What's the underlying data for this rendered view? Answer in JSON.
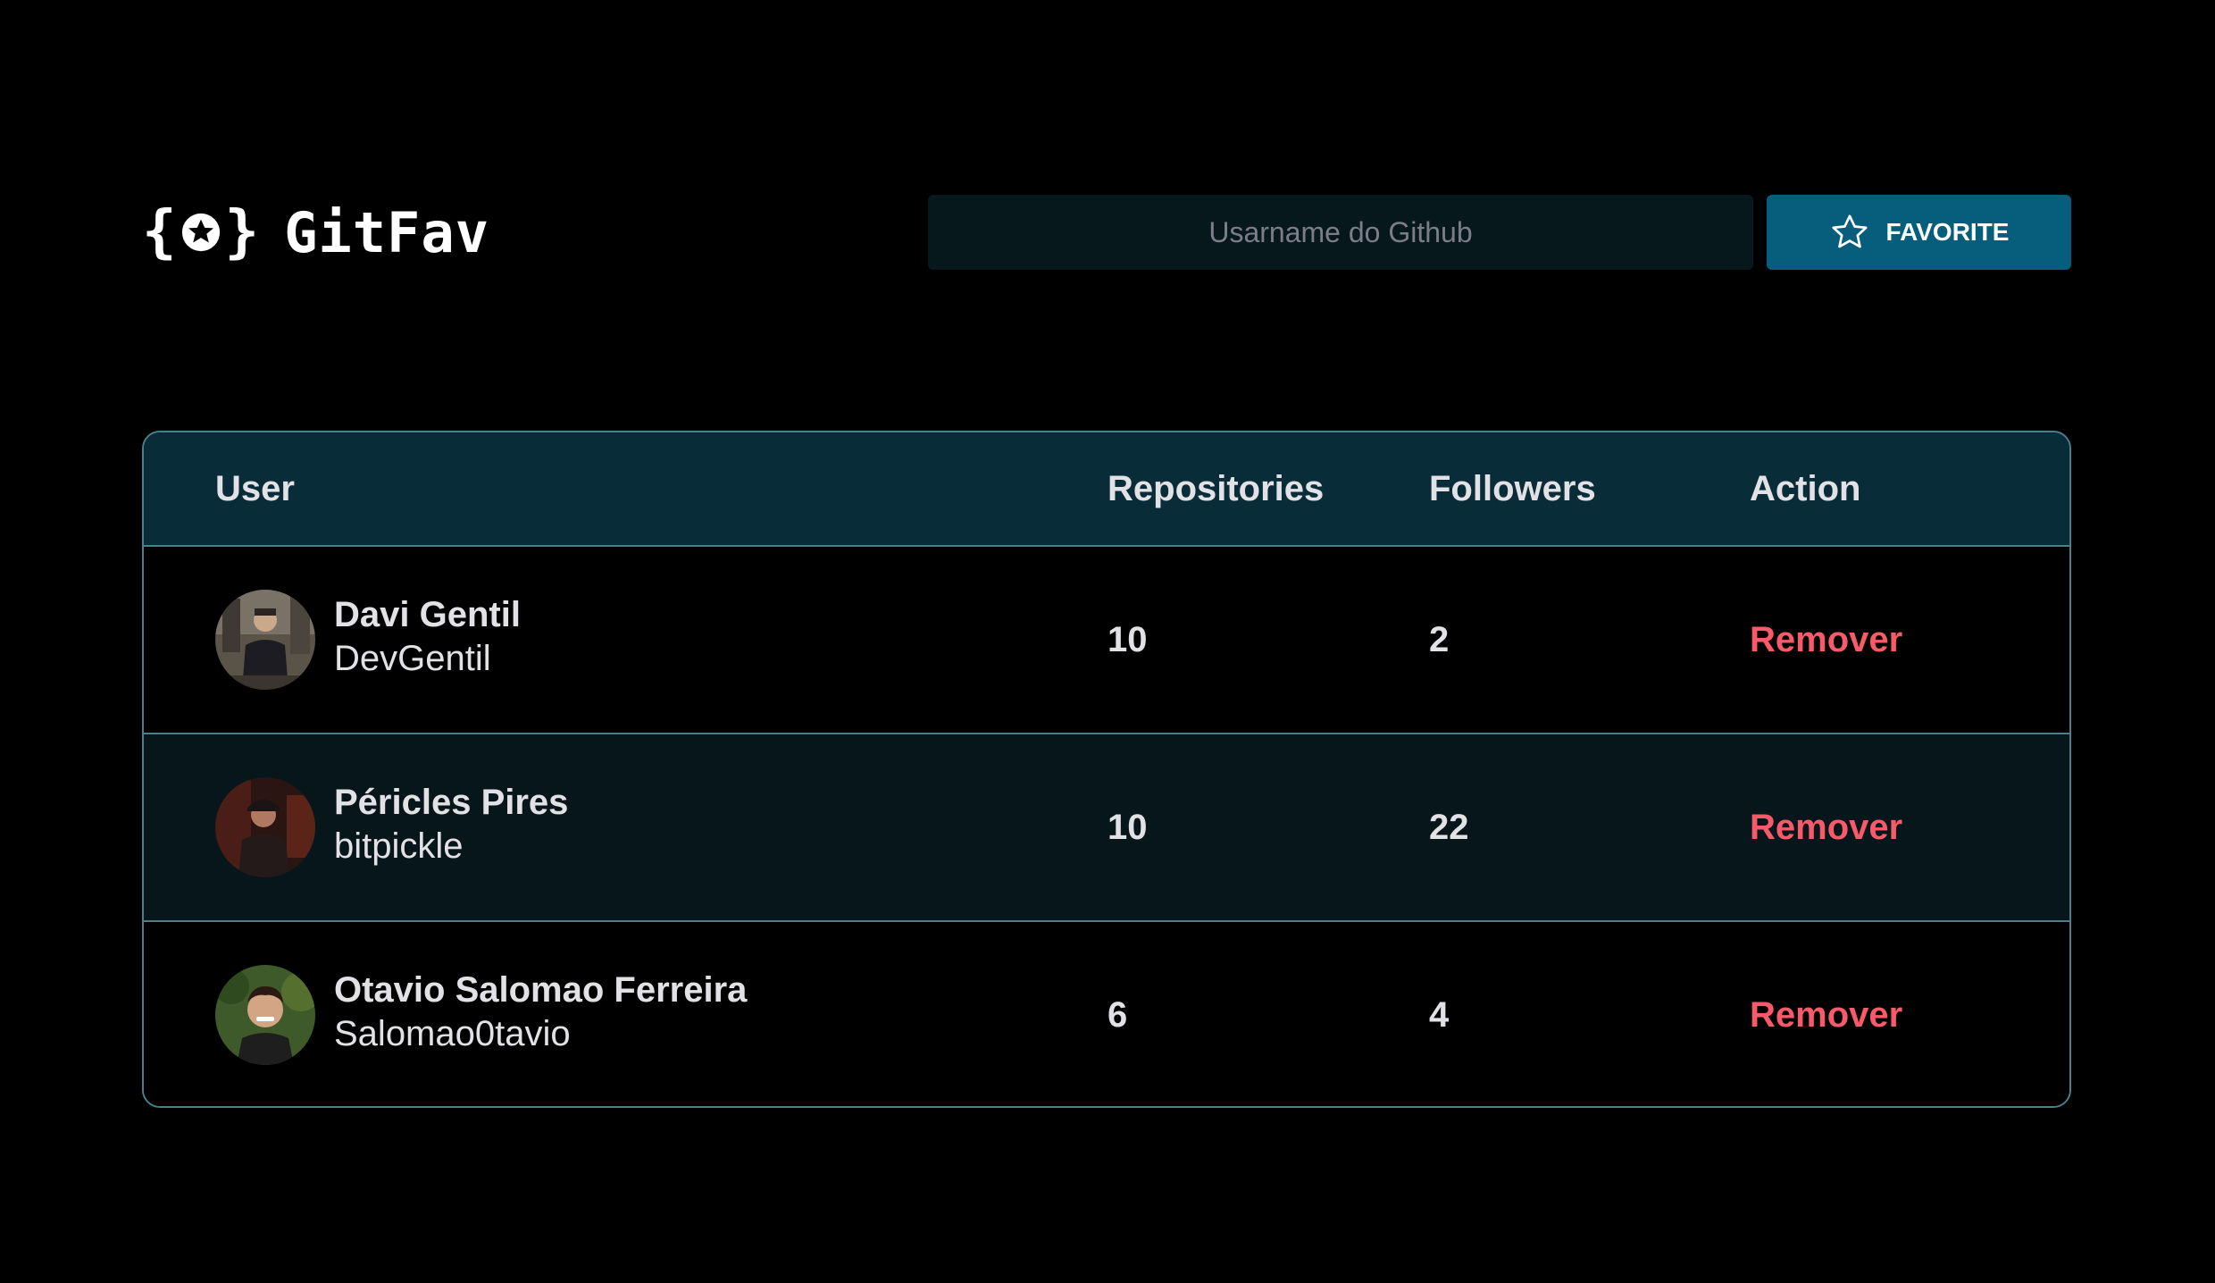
{
  "app": {
    "name": "GitFav",
    "logo_icon": "braces-star-icon"
  },
  "search": {
    "placeholder": "Usarname do Github",
    "value": ""
  },
  "favorite_button": {
    "label": "FAVORITE",
    "icon": "star-outline-icon"
  },
  "colors": {
    "background": "#000000",
    "header_row": "#092D38",
    "accent_button": "#065E7C",
    "border": "#4A808C",
    "remove_text": "#F75A68",
    "text": "#E1E1E6"
  },
  "table": {
    "headers": {
      "user": "User",
      "repositories": "Repositories",
      "followers": "Followers",
      "action": "Action"
    },
    "rows": [
      {
        "name": "Davi Gentil",
        "login": "DevGentil",
        "repositories": "10",
        "followers": "2",
        "action": "Remover"
      },
      {
        "name": "Péricles Pires",
        "login": "bitpickle",
        "repositories": "10",
        "followers": "22",
        "action": "Remover"
      },
      {
        "name": "Otavio Salomao Ferreira",
        "login": "Salomao0tavio",
        "repositories": "6",
        "followers": "4",
        "action": "Remover"
      }
    ]
  }
}
